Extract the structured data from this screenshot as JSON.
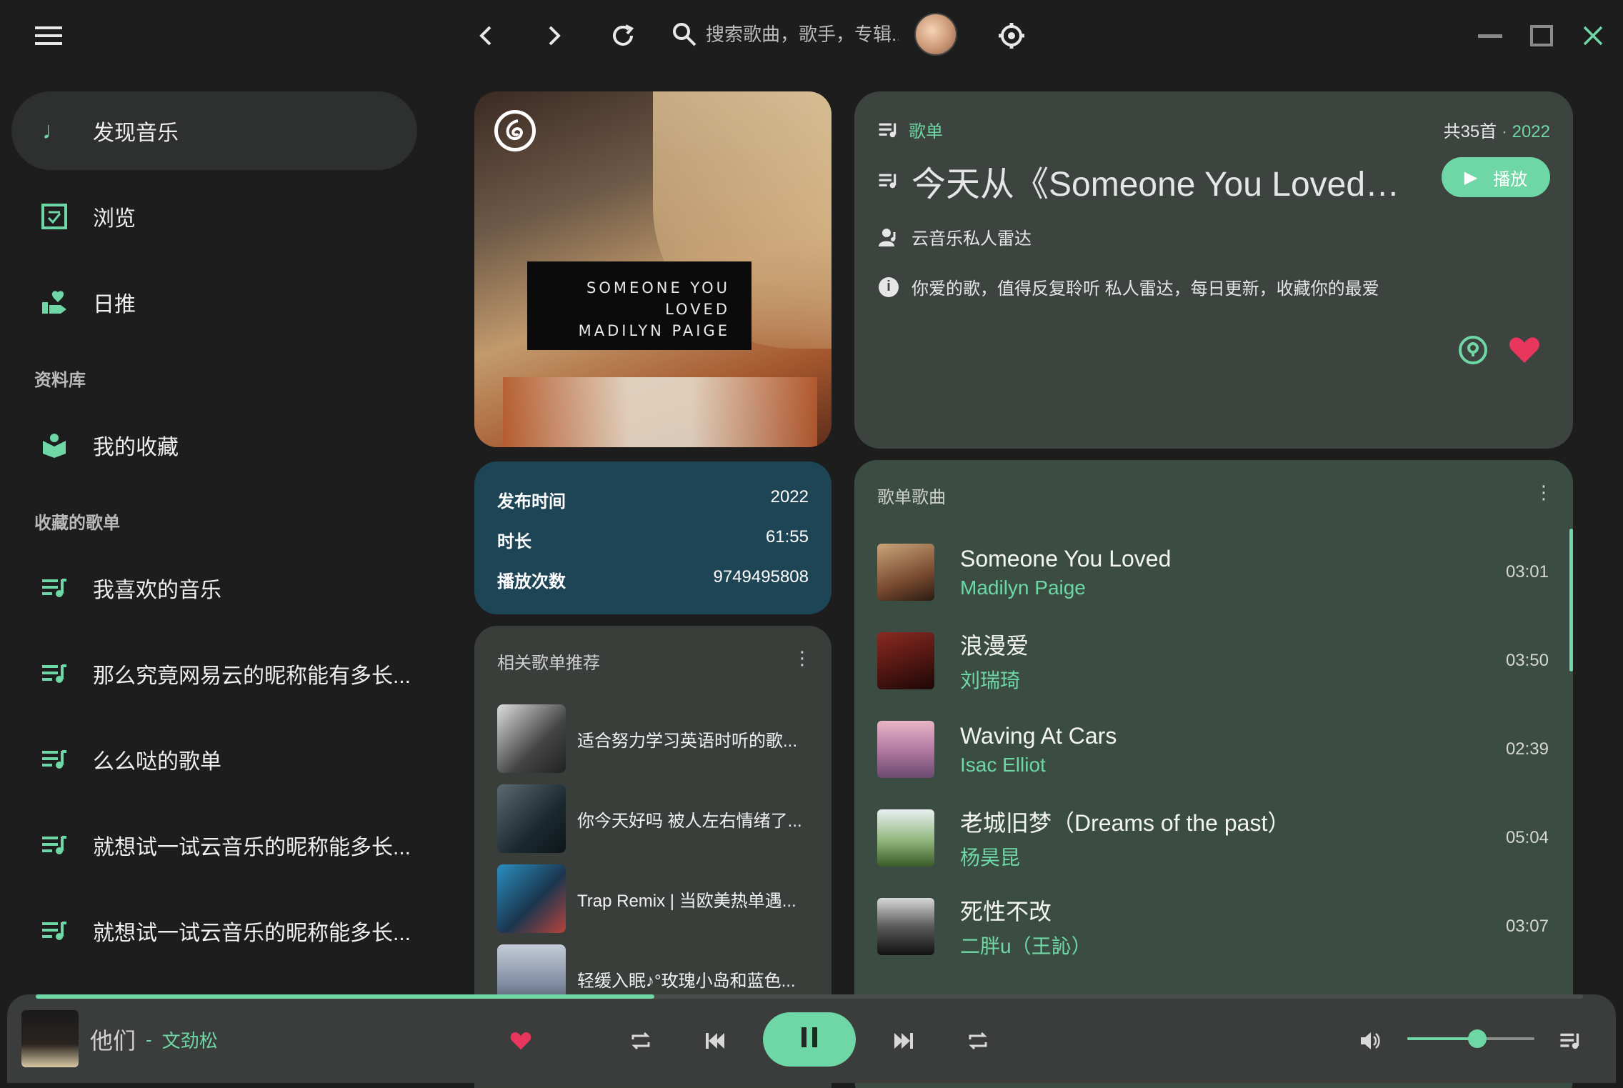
{
  "titlebar": {
    "search_placeholder": "搜索歌曲，歌手，专辑...",
    "menu_icon": "hamburger-menu-icon",
    "back_icon": "chevron-left-icon",
    "forward_icon": "chevron-right-icon",
    "refresh_icon": "refresh-icon",
    "settings_icon": "gear-icon",
    "window_controls": [
      "minimize-icon",
      "maximize-icon",
      "close-icon"
    ]
  },
  "sidebar": {
    "items": [
      {
        "label": "发现音乐",
        "icon": "music-note-icon",
        "active": true
      },
      {
        "label": "浏览",
        "icon": "browse-icon"
      },
      {
        "label": "日推",
        "icon": "recommend-icon"
      }
    ],
    "library_title": "资料库",
    "library_items": [
      {
        "label": "我的收藏",
        "icon": "collection-icon"
      }
    ],
    "playlists_title": "收藏的歌单",
    "playlists": [
      {
        "label": "我喜欢的音乐",
        "icon": "playlist-icon"
      },
      {
        "label": "那么究竟网易云的昵称能有多长...",
        "icon": "playlist-icon"
      },
      {
        "label": "么么哒的歌单",
        "icon": "playlist-icon"
      },
      {
        "label": "就想试一试云音乐的昵称能多长...",
        "icon": "playlist-icon"
      },
      {
        "label": "就想试一试云音乐的昵称能多长...",
        "icon": "playlist-icon"
      }
    ]
  },
  "cover": {
    "line1": "SOMEONE YOU LOVED",
    "line2": "MADILYN PAIGE"
  },
  "playlist": {
    "type_label": "歌单",
    "count": "共35首",
    "dot": " · ",
    "year": "2022",
    "title": "今天从《Someone You Loved》...",
    "play_label": "播放",
    "creator": "云音乐私人雷达",
    "description": "你爱的歌，值得反复聆听 私人雷达，每日更新，收藏你的最爱"
  },
  "meta": {
    "release_key": "发布时间",
    "release_val": "2022",
    "duration_key": "时长",
    "duration_val": "61:55",
    "plays_key": "播放次数",
    "plays_val": "9749495808"
  },
  "related": {
    "title": "相关歌单推荐",
    "items": [
      {
        "label": "适合努力学习英语时听的歌..."
      },
      {
        "label": "你今天好吗 被人左右情绪了..."
      },
      {
        "label": "Trap Remix | 当欧美热单遇..."
      },
      {
        "label": "轻缓入眠♪°玫瑰小岛和蓝色..."
      }
    ]
  },
  "songs": {
    "title": "歌单歌曲",
    "items": [
      {
        "title": "Someone You Loved",
        "artist": "Madilyn Paige",
        "duration": "03:01"
      },
      {
        "title": "浪漫爱",
        "artist": "刘瑞琦",
        "duration": "03:50"
      },
      {
        "title": "Waving At Cars",
        "artist": "Isac Elliot",
        "duration": "02:39"
      },
      {
        "title": "老城旧梦（Dreams of the past）",
        "artist": "杨昊昆",
        "duration": "05:04"
      },
      {
        "title": "死性不改",
        "artist": "二胖u（王訫）",
        "duration": "03:07"
      }
    ]
  },
  "player": {
    "title": "他们",
    "separator": "-",
    "artist": "文劲松",
    "progress": 0.4,
    "volume": 0.55,
    "accent": "#6fd6a6",
    "like_color": "#e8365d"
  }
}
